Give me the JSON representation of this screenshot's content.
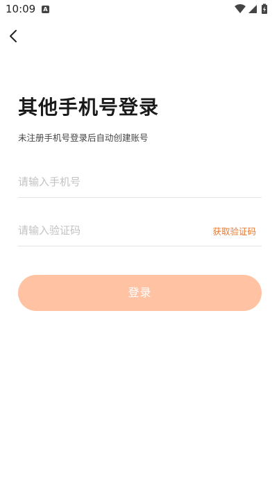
{
  "status_bar": {
    "time": "10:09",
    "notification_icon": "a-icon",
    "icons": [
      "wifi-icon",
      "signal-icon",
      "battery-charging-icon"
    ]
  },
  "header": {
    "back_icon": "chevron-left-icon"
  },
  "main": {
    "title": "其他手机号登录",
    "subtitle": "未注册手机号登录后自动创建账号",
    "phone_input": {
      "placeholder": "请输入手机号",
      "value": ""
    },
    "code_input": {
      "placeholder": "请输入验证码",
      "value": ""
    },
    "get_code_label": "获取验证码",
    "login_label": "登录"
  },
  "colors": {
    "accent": "#e87a34",
    "login_button_bg": "#ffc3a4",
    "title": "#1a1a1a"
  }
}
